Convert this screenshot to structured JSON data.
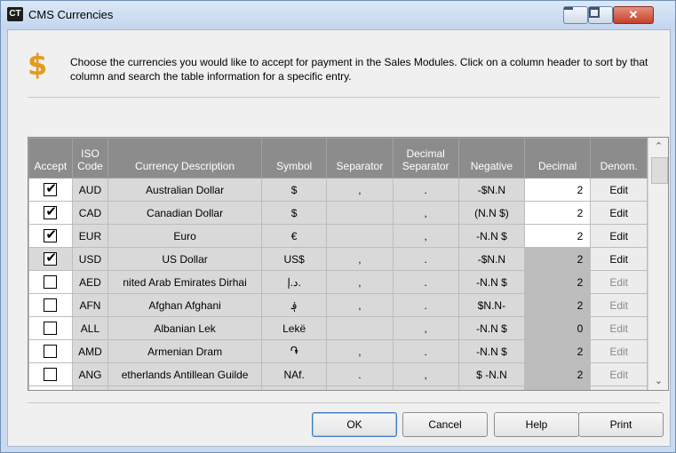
{
  "window": {
    "icon_text": "CT",
    "title": "CMS Currencies"
  },
  "header": {
    "icon": "dollar-sign-icon",
    "icon_glyph": "$",
    "icon_color": "#e59a1a",
    "text": "Choose the currencies you would like to accept for payment in the Sales Modules.  Click on a column header to sort by that column and search the table information for a specific entry."
  },
  "table": {
    "columns": {
      "accept": "Accept",
      "iso_top": "ISO",
      "iso_bottom": "Code",
      "description": "Currency Description",
      "symbol": "Symbol",
      "separator": "Separator",
      "decsep_top": "Decimal",
      "decsep_bottom": "Separator",
      "negative": "Negative",
      "decimal": "Decimal",
      "denom": "Denom."
    },
    "rows": [
      {
        "accept": true,
        "iso": "AUD",
        "description": "Australian Dollar",
        "symbol": "$",
        "separator": ",",
        "decsep": ".",
        "negative": "-$N.N",
        "decimal": "2",
        "denom": "Edit"
      },
      {
        "accept": true,
        "iso": "CAD",
        "description": "Canadian Dollar",
        "symbol": "$",
        "separator": "",
        "decsep": ",",
        "negative": "(N.N $)",
        "decimal": "2",
        "denom": "Edit"
      },
      {
        "accept": true,
        "iso": "EUR",
        "description": "Euro",
        "symbol": "€",
        "separator": "",
        "decsep": ",",
        "negative": "-N.N $",
        "decimal": "2",
        "denom": "Edit"
      },
      {
        "accept": true,
        "iso": "USD",
        "description": "US Dollar",
        "symbol": "US$",
        "separator": ",",
        "decsep": ".",
        "negative": "-$N.N",
        "decimal": "2",
        "denom": "Edit"
      },
      {
        "accept": false,
        "iso": "AED",
        "description": "nited Arab Emirates Dirhai",
        "symbol": "د.إ.",
        "separator": ",",
        "decsep": ".",
        "negative": "-N.N $",
        "decimal": "2",
        "denom": "Edit"
      },
      {
        "accept": false,
        "iso": "AFN",
        "description": "Afghan Afghani",
        "symbol": "؋",
        "separator": ",",
        "decsep": ".",
        "negative": "$N.N-",
        "decimal": "2",
        "denom": "Edit"
      },
      {
        "accept": false,
        "iso": "ALL",
        "description": "Albanian Lek",
        "symbol": "Lekë",
        "separator": "",
        "decsep": ",",
        "negative": "-N.N $",
        "decimal": "0",
        "denom": "Edit"
      },
      {
        "accept": false,
        "iso": "AMD",
        "description": "Armenian Dram",
        "symbol": "֏",
        "separator": ",",
        "decsep": ".",
        "negative": "-N.N $",
        "decimal": "2",
        "denom": "Edit"
      },
      {
        "accept": false,
        "iso": "ANG",
        "description": "etherlands Antillean Guilde",
        "symbol": "NAf.",
        "separator": ".",
        "decsep": ",",
        "negative": "$ -N.N",
        "decimal": "2",
        "denom": "Edit"
      }
    ]
  },
  "buttons": {
    "ok": "OK",
    "cancel": "Cancel",
    "help": "Help",
    "print": "Print"
  }
}
